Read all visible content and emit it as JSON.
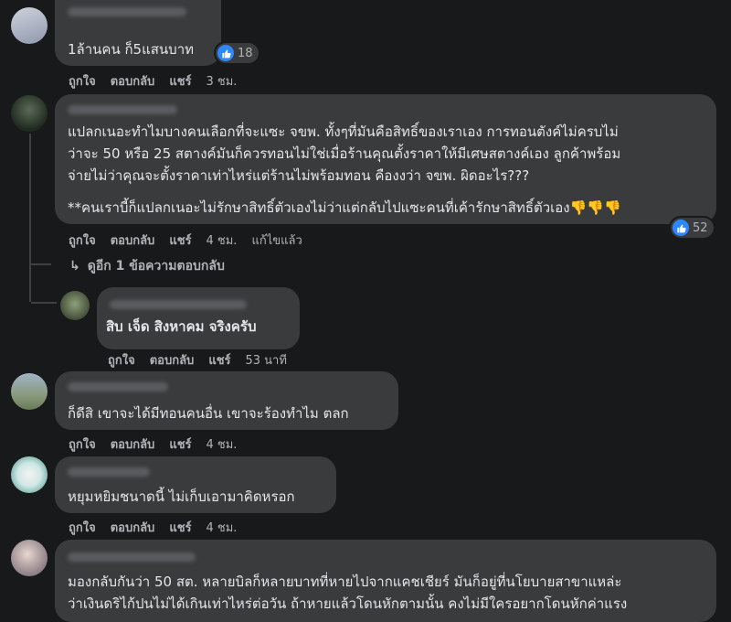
{
  "comments": [
    {
      "text": "1ล้านคน ก็5แสนบาท",
      "reaction_count": "18",
      "actions": {
        "like": "ถูกใจ",
        "reply": "ตอบกลับ",
        "share": "แชร์",
        "time": "3 ชม."
      }
    },
    {
      "lines": [
        "แปลกเนอะทำไมบางคนเลือกที่จะแซะ จขพ. ทั้งๆที่มันคือสิทธิ์ของเราเอง การทอนตังค์ไม่ครบไม่",
        "ว่าจะ 50 หรือ 25 สตางค์มันก็ควรทอนไม่ใช่เมื่อร้านคุณตั้งราคาให้มีเศษสตางค์เอง ลูกค้าพร้อม",
        "จ่ายไม่ว่าคุณจะตั้งราคาเท่าไหร่แต่ร้านไม่พร้อมทอน คืองงว่า จขพ. ผิดอะไร???",
        "**คนเราบี้ก็แปลกเนอะไม่รักษาสิทธิ์ตัวเองไม่ว่าแต่กลับไปแซะคนที่เค้ารักษาสิทธิ์ตัวเอง"
      ],
      "emoji": "👎👎👎",
      "reaction_count": "52",
      "actions": {
        "like": "ถูกใจ",
        "reply": "ตอบกลับ",
        "share": "แชร์",
        "time": "4 ชม.",
        "edited": "แก้ไขแล้ว"
      },
      "more_replies": "ดูอีก 1 ข้อความตอบกลับ"
    },
    {
      "text": "สิบ เจ็ด สิงหาคม จริงครับ",
      "actions": {
        "like": "ถูกใจ",
        "reply": "ตอบกลับ",
        "share": "แชร์",
        "time": "53 นาที"
      }
    },
    {
      "text": "ก็ดีสิ เขาจะได้มีทอนคนอื่น เขาจะร้องทำไม ตลก",
      "actions": {
        "like": "ถูกใจ",
        "reply": "ตอบกลับ",
        "share": "แชร์",
        "time": "4 ชม."
      }
    },
    {
      "text": "หยุมหยิมชนาดนี้ ไม่เก็บเอามาคิดหรอก",
      "actions": {
        "like": "ถูกใจ",
        "reply": "ตอบกลับ",
        "share": "แชร์",
        "time": "4 ชม."
      }
    },
    {
      "lines": [
        "มองกลับกันว่า 50 สต. หลายบิลก็หลายบาทที่หายไปจากแคชเชียร์ มันก็อยู่ที่นโยบายสาขาแหล่ะ",
        "ว่าเงินดริไก้ปนไม่ได้เกินเท่าไหร่ต่อวัน ถ้าหายแล้วโดนหักตามนั้น คงไม่มีใครอยากโดนหักค่าแรง"
      ]
    }
  ],
  "colors": {
    "bg": "#18191a",
    "bubble": "#3a3b3c",
    "text": "#e4e6eb",
    "muted": "#b0b3b8",
    "like": "#2d88ff"
  }
}
